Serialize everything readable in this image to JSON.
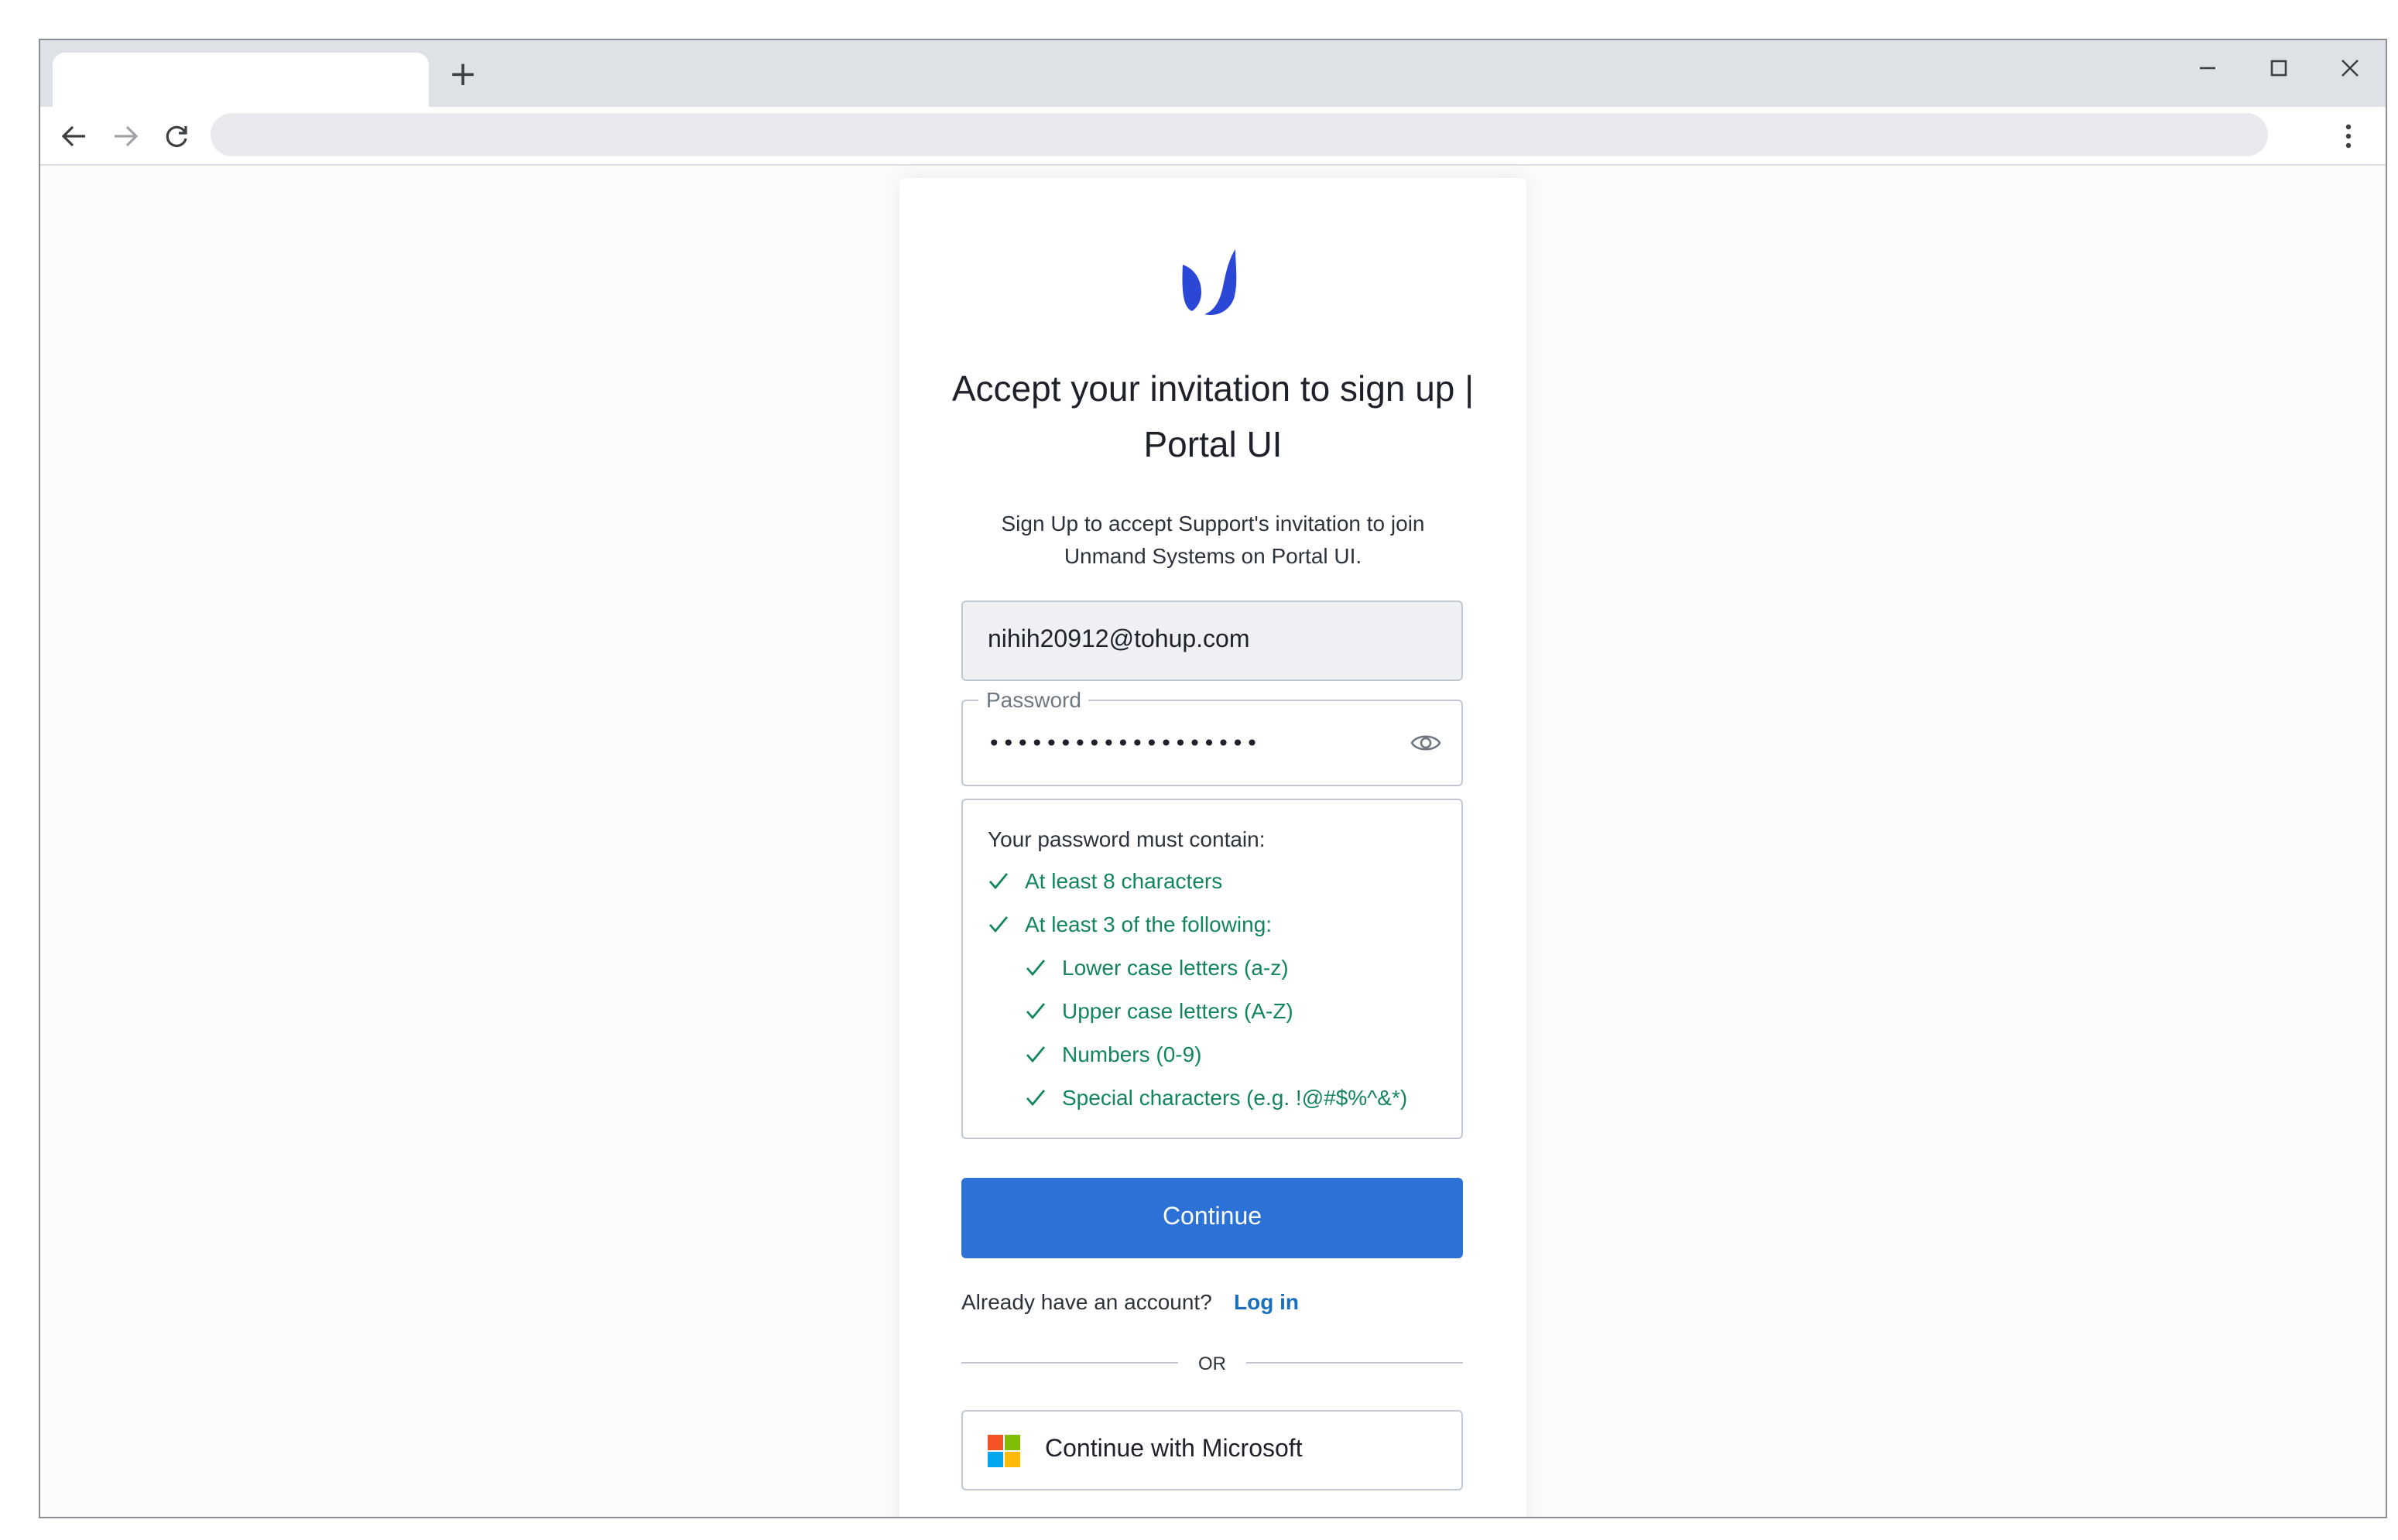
{
  "browser": {
    "new_tab_label": "+",
    "tab_title": "",
    "address": ""
  },
  "card": {
    "title": "Accept your invitation to sign up | Portal UI",
    "subtitle": "Sign Up to accept Support's invitation to join Unmand Systems on Portal UI.",
    "email_value": "nihih20912@tohup.com",
    "password_label": "Password",
    "password_value": "•••••••••••••••••••",
    "rules_heading": "Your password must contain:",
    "rules": [
      {
        "label": "At least 8 characters",
        "met": true,
        "level": 0
      },
      {
        "label": "At least 3 of the following:",
        "met": true,
        "level": 0
      },
      {
        "label": "Lower case letters (a-z)",
        "met": true,
        "level": 1
      },
      {
        "label": "Upper case letters (A-Z)",
        "met": true,
        "level": 1
      },
      {
        "label": "Numbers (0-9)",
        "met": true,
        "level": 1
      },
      {
        "label": "Special characters (e.g. !@#$%^&*)",
        "met": true,
        "level": 1
      }
    ],
    "continue_label": "Continue",
    "already_text": "Already have an account?",
    "login_link": "Log in",
    "or_text": "OR",
    "microsoft_label": "Continue with Microsoft"
  },
  "colors": {
    "accent": "#2c72d6",
    "success": "#13855e",
    "link": "#1a6fbd",
    "logo": "#2a47d6"
  },
  "icons": [
    "back-arrow-icon",
    "forward-arrow-icon",
    "reload-icon",
    "minimize-icon",
    "maximize-icon",
    "close-icon",
    "more-vert-icon",
    "eye-icon",
    "check-icon",
    "microsoft-logo-icon",
    "brand-logo"
  ]
}
